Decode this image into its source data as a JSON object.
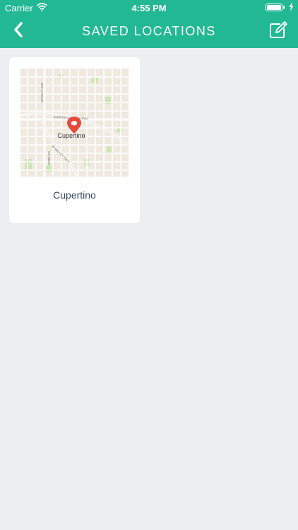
{
  "status_bar": {
    "carrier": "Carrier",
    "time": "4:55 PM",
    "wifi_icon": "wifi-icon",
    "battery_icon": "battery-icon"
  },
  "nav": {
    "title": "SAVED LOCATIONS",
    "back_icon": "chevron-left-icon",
    "edit_icon": "edit-icon"
  },
  "colors": {
    "header": "#22b894",
    "background": "#ebeff0",
    "card": "#ffffff",
    "label": "#34495e",
    "pin": "#e8493b"
  },
  "locations": [
    {
      "name": "Cupertino",
      "map": {
        "city_label": "Cupertino",
        "road_labels": [
          "WRIGHT AVE",
          "JUNIPERO SERRA FWY",
          "W VALLEY FWY",
          "BUBB RD"
        ],
        "pin_icon": "map-pin-icon"
      }
    }
  ]
}
